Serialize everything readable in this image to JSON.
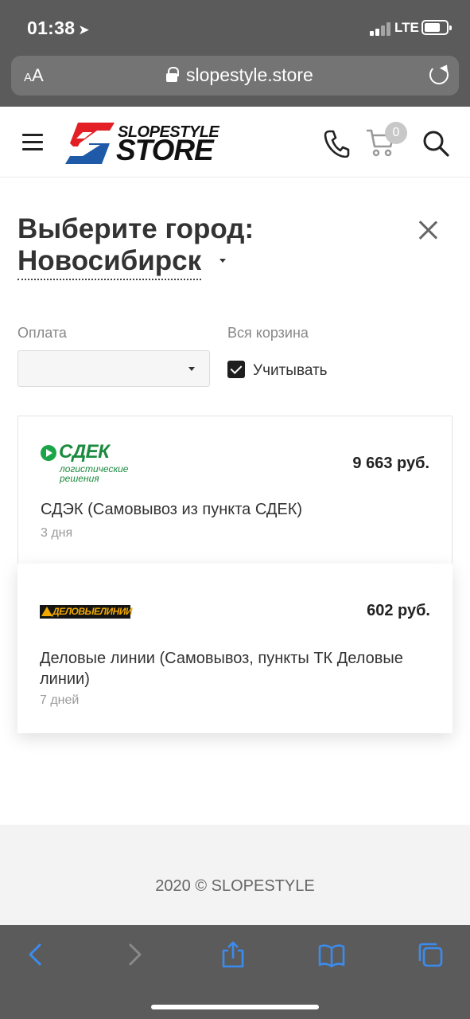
{
  "status_bar": {
    "time": "01:38",
    "network": "LTE"
  },
  "browser": {
    "text_size_label": "AA",
    "url": "slopestyle.store"
  },
  "header": {
    "logo_line1": "SLOPESTYLE",
    "logo_line2": "STORE",
    "cart_count": "0",
    "colors": {
      "logo_red": "#e31e24",
      "logo_blue": "#1e5aa8"
    }
  },
  "modal": {
    "title": "Выберите город:",
    "city": "Новосибирск",
    "payment_label": "Оплата",
    "payment_value": "",
    "cart_label": "Вся корзина",
    "cart_checkbox_label": "Учитывать",
    "cart_checkbox_checked": true
  },
  "deliveries": [
    {
      "carrier_logo_word": "СДЕК",
      "carrier_logo_sub1": "логистические",
      "carrier_logo_sub2": "решения",
      "price": "9 663 руб.",
      "service": "СДЭК (Самовывоз из пункта СДЕК)",
      "days": "3 дня"
    },
    {
      "carrier_logo_word": "ДЕЛОВЫЕЛИНИИ",
      "price": "602 руб.",
      "service": "Деловые линии (Самовывоз, пункты ТК Деловые линии)",
      "days": "7 дней"
    }
  ],
  "footer": {
    "copyright": "2020 © SLOPESTYLE"
  }
}
